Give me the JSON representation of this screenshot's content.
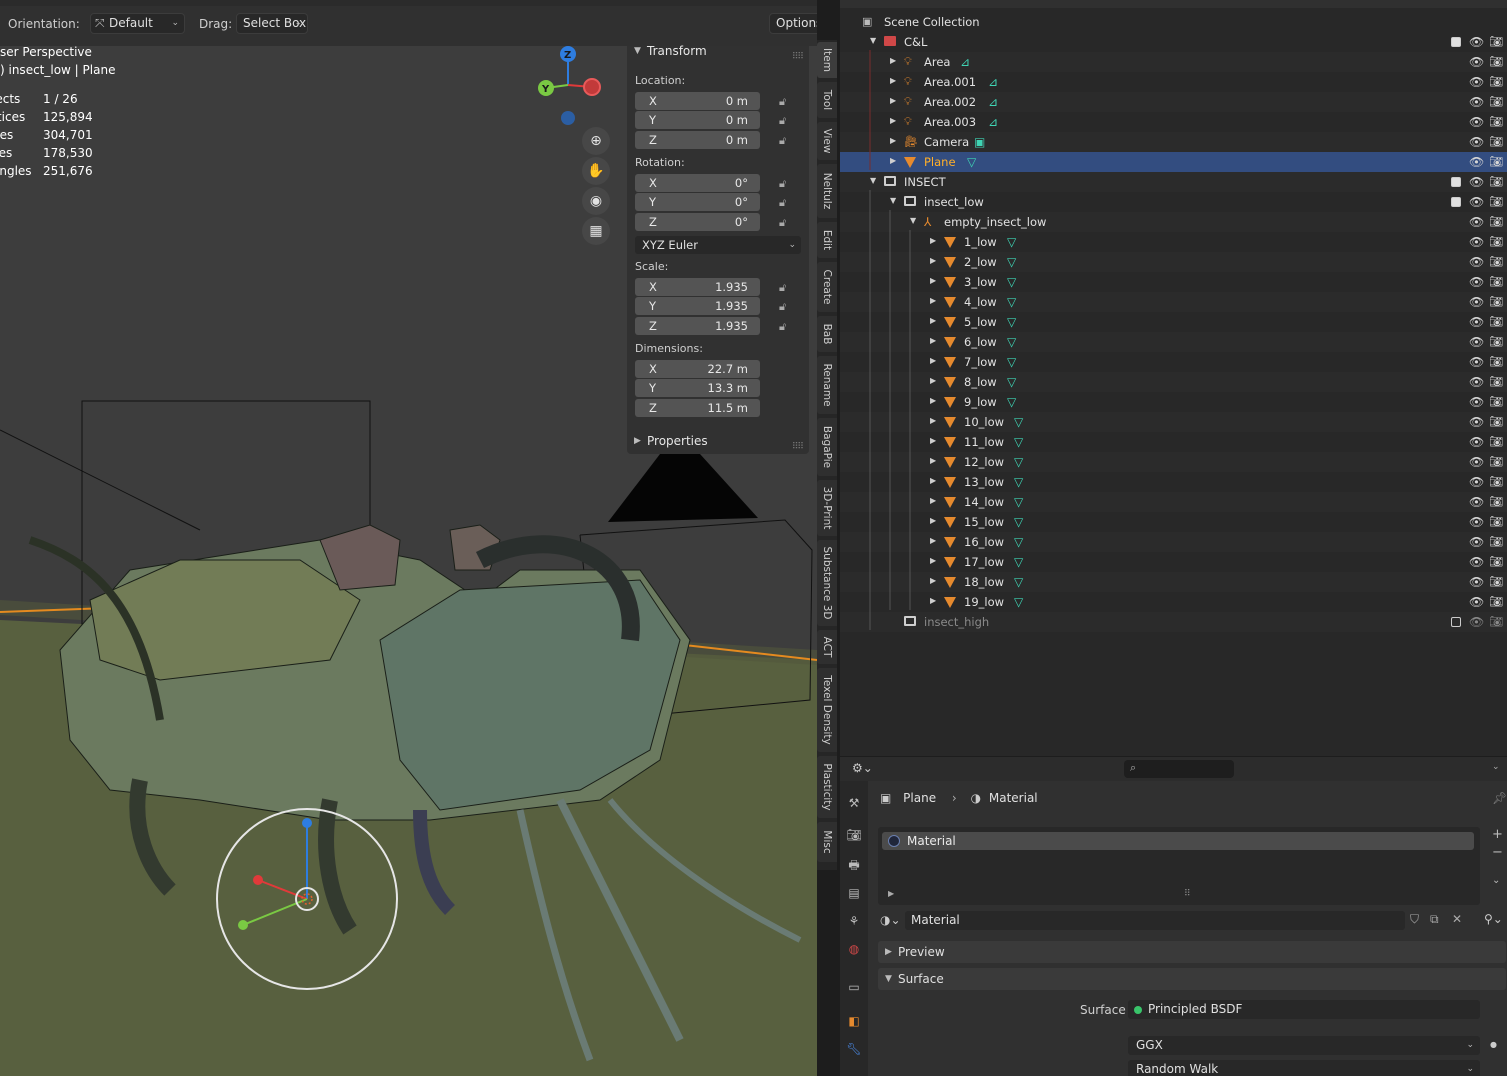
{
  "header": {
    "orientation_label": "Orientation:",
    "orientation_value": "Default",
    "drag_label": "Drag:",
    "drag_value": "Select Box",
    "options_label": "Options"
  },
  "overlay": {
    "view_name": "ser Perspective",
    "object_info": ") insect_low | Plane",
    "stats": [
      {
        "k": "jects",
        "v": "1 / 26"
      },
      {
        "k": "rtices",
        "v": "125,894"
      },
      {
        "k": "ges",
        "v": "304,701"
      },
      {
        "k": "ces",
        "v": "178,530"
      },
      {
        "k": "angles",
        "v": "251,676"
      }
    ]
  },
  "gizmo": {
    "y_label": "Y",
    "z_label": "Z"
  },
  "npanel": {
    "transform_title": "Transform",
    "location_label": "Location:",
    "location": [
      {
        "ax": "X",
        "val": "0 m"
      },
      {
        "ax": "Y",
        "val": "0 m"
      },
      {
        "ax": "Z",
        "val": "0 m"
      }
    ],
    "rotation_label": "Rotation:",
    "rotation": [
      {
        "ax": "X",
        "val": "0°"
      },
      {
        "ax": "Y",
        "val": "0°"
      },
      {
        "ax": "Z",
        "val": "0°"
      }
    ],
    "rotation_mode": "XYZ Euler",
    "scale_label": "Scale:",
    "scale": [
      {
        "ax": "X",
        "val": "1.935"
      },
      {
        "ax": "Y",
        "val": "1.935"
      },
      {
        "ax": "Z",
        "val": "1.935"
      }
    ],
    "dimensions_label": "Dimensions:",
    "dimensions": [
      {
        "ax": "X",
        "val": "22.7 m"
      },
      {
        "ax": "Y",
        "val": "13.3 m"
      },
      {
        "ax": "Z",
        "val": "11.5 m"
      }
    ],
    "properties_title": "Properties"
  },
  "side_tabs": [
    "Item",
    "Tool",
    "View",
    "Neltulz",
    "Edit",
    "Create",
    "BaB",
    "Rename",
    "BagaPie",
    "3D-Print",
    "Substance 3D",
    "ACT",
    "Texel Density",
    "Plasticity",
    "Misc"
  ],
  "outliner": {
    "scene_collection": "Scene Collection",
    "rows": [
      {
        "name": "C&L",
        "type": "collection-red",
        "depth": 0,
        "exp": "down",
        "chk": true
      },
      {
        "name": "Area",
        "type": "light",
        "depth": 1,
        "exp": "right",
        "data": "light"
      },
      {
        "name": "Area.001",
        "type": "light",
        "depth": 1,
        "exp": "right",
        "data": "light"
      },
      {
        "name": "Area.002",
        "type": "light",
        "depth": 1,
        "exp": "right",
        "data": "light"
      },
      {
        "name": "Area.003",
        "type": "light",
        "depth": 1,
        "exp": "right",
        "data": "light"
      },
      {
        "name": "Camera",
        "type": "camera",
        "depth": 1,
        "exp": "right",
        "data": "camera"
      },
      {
        "name": "Plane",
        "type": "mesh",
        "depth": 1,
        "exp": "right",
        "data": "mesh",
        "sel": true
      },
      {
        "name": "INSECT",
        "type": "collection",
        "depth": 0,
        "exp": "down",
        "chk": true
      },
      {
        "name": "insect_low",
        "type": "collection",
        "depth": 1,
        "exp": "down",
        "chk": true
      },
      {
        "name": "empty_insect_low",
        "type": "empty",
        "depth": 2,
        "exp": "down"
      },
      {
        "name": "1_low",
        "type": "mesh",
        "depth": 3,
        "exp": "right",
        "data": "mesh"
      },
      {
        "name": "2_low",
        "type": "mesh",
        "depth": 3,
        "exp": "right",
        "data": "mesh"
      },
      {
        "name": "3_low",
        "type": "mesh",
        "depth": 3,
        "exp": "right",
        "data": "mesh"
      },
      {
        "name": "4_low",
        "type": "mesh",
        "depth": 3,
        "exp": "right",
        "data": "mesh"
      },
      {
        "name": "5_low",
        "type": "mesh",
        "depth": 3,
        "exp": "right",
        "data": "mesh"
      },
      {
        "name": "6_low",
        "type": "mesh",
        "depth": 3,
        "exp": "right",
        "data": "mesh"
      },
      {
        "name": "7_low",
        "type": "mesh",
        "depth": 3,
        "exp": "right",
        "data": "mesh"
      },
      {
        "name": "8_low",
        "type": "mesh",
        "depth": 3,
        "exp": "right",
        "data": "mesh"
      },
      {
        "name": "9_low",
        "type": "mesh",
        "depth": 3,
        "exp": "right",
        "data": "mesh"
      },
      {
        "name": "10_low",
        "type": "mesh",
        "depth": 3,
        "exp": "right",
        "data": "mesh"
      },
      {
        "name": "11_low",
        "type": "mesh",
        "depth": 3,
        "exp": "right",
        "data": "mesh"
      },
      {
        "name": "12_low",
        "type": "mesh",
        "depth": 3,
        "exp": "right",
        "data": "mesh"
      },
      {
        "name": "13_low",
        "type": "mesh",
        "depth": 3,
        "exp": "right",
        "data": "mesh"
      },
      {
        "name": "14_low",
        "type": "mesh",
        "depth": 3,
        "exp": "right",
        "data": "mesh"
      },
      {
        "name": "15_low",
        "type": "mesh",
        "depth": 3,
        "exp": "right",
        "data": "mesh"
      },
      {
        "name": "16_low",
        "type": "mesh",
        "depth": 3,
        "exp": "right",
        "data": "mesh"
      },
      {
        "name": "17_low",
        "type": "mesh",
        "depth": 3,
        "exp": "right",
        "data": "mesh"
      },
      {
        "name": "18_low",
        "type": "mesh",
        "depth": 3,
        "exp": "right",
        "data": "mesh"
      },
      {
        "name": "19_low",
        "type": "mesh",
        "depth": 3,
        "exp": "right",
        "data": "mesh"
      },
      {
        "name": "insect_high",
        "type": "collection",
        "depth": 1,
        "exp": "none",
        "chk": false,
        "dim": true
      }
    ]
  },
  "properties": {
    "breadcrumb_object": "Plane",
    "breadcrumb_sep": "›",
    "breadcrumb_material": "Material",
    "slot_name": "Material",
    "material_name": "Material",
    "preview_title": "Preview",
    "surface_title": "Surface",
    "surface_label": "Surface",
    "surface_shader": "Principled BSDF",
    "distribution": "GGX",
    "subsurface_method": "Random Walk"
  },
  "colors": {
    "accent": "#ffaf29",
    "selection": "#334d80",
    "mesh_data": "#3fd4b4",
    "object_orange": "#e68a2e"
  }
}
